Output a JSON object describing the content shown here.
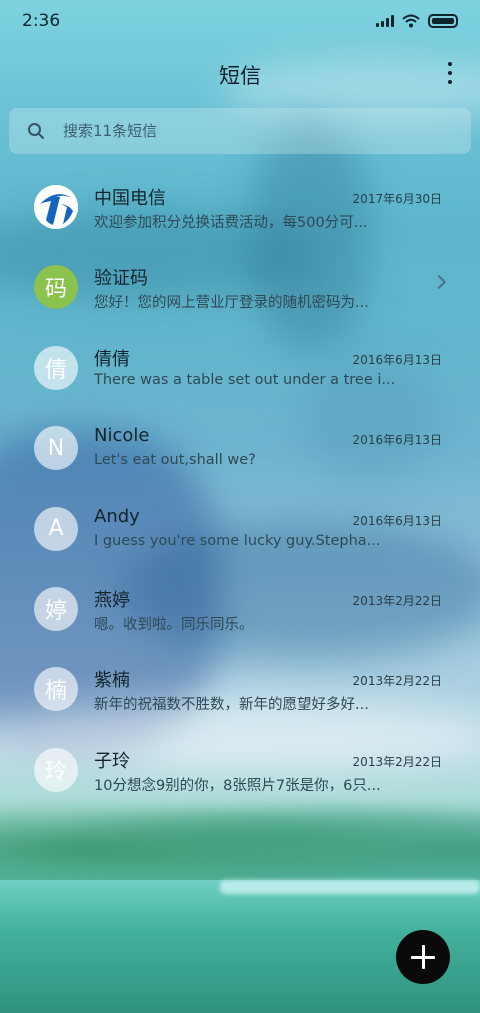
{
  "status_bar": {
    "time": "2:36"
  },
  "header": {
    "title": "短信",
    "more_icon": "more-vertical-icon"
  },
  "search": {
    "placeholder": "搜索11条短信",
    "icon": "search-icon"
  },
  "conversations": [
    {
      "name": "中国电信",
      "date": "2017年6月30日",
      "preview": "欢迎参加积分兑换话费活动，每500分可...",
      "avatar_type": "logo",
      "avatar_text": ""
    },
    {
      "name": "验证码",
      "date": "",
      "preview": "您好！您的网上营业厅登录的随机密码为...",
      "avatar_type": "green",
      "avatar_text": "码",
      "has_chevron": true
    },
    {
      "name": "倩倩",
      "date": "2016年6月13日",
      "preview": "There was a table set out under a tree i...",
      "avatar_type": "plain",
      "avatar_text": "倩"
    },
    {
      "name": "Nicole",
      "date": "2016年6月13日",
      "preview": "Let's eat out,shall we?",
      "avatar_type": "plain",
      "avatar_text": "N"
    },
    {
      "name": "Andy",
      "date": "2016年6月13日",
      "preview": "I guess you're some lucky guy.Stepha...",
      "avatar_type": "plain",
      "avatar_text": "A"
    },
    {
      "name": "燕婷",
      "date": "2013年2月22日",
      "preview": "嗯。收到啦。同乐同乐。",
      "avatar_type": "plain",
      "avatar_text": "婷"
    },
    {
      "name": "紫楠",
      "date": "2013年2月22日",
      "preview": "新年的祝福数不胜数，新年的愿望好多好...",
      "avatar_type": "plain",
      "avatar_text": "楠"
    },
    {
      "name": "子玲",
      "date": "2013年2月22日",
      "preview": "10分想念9别的你，8张照片7张是你，6只...",
      "avatar_type": "plain",
      "avatar_text": "玲"
    }
  ],
  "fab": {
    "icon": "plus-icon"
  },
  "colors": {
    "fab": "#0a0a0a",
    "verification_avatar": "#8cc24e",
    "telecom_blue": "#1565c0"
  }
}
